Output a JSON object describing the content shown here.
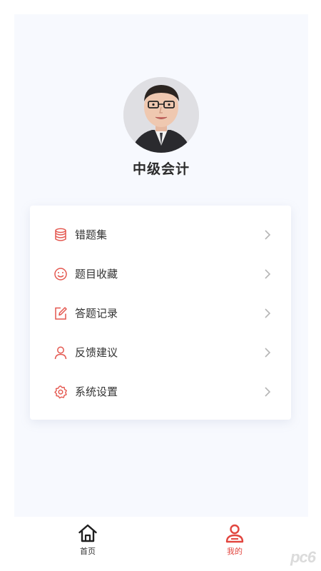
{
  "profile": {
    "name": "中级会计"
  },
  "menu": {
    "items": [
      {
        "label": "错题集",
        "icon": "database-icon"
      },
      {
        "label": "题目收藏",
        "icon": "smile-icon"
      },
      {
        "label": "答题记录",
        "icon": "edit-icon"
      },
      {
        "label": "反馈建议",
        "icon": "user-icon"
      },
      {
        "label": "系统设置",
        "icon": "gear-icon"
      }
    ]
  },
  "tabbar": {
    "home_label": "首页",
    "mine_label": "我的",
    "active_tab": "mine"
  },
  "watermark": {
    "text": "pc6"
  },
  "colors": {
    "accent": "#e2463f",
    "icon_red": "#e4574f",
    "text_dark": "#333333",
    "background": "#f7f9fe",
    "arrow": "#b5b5b5"
  }
}
